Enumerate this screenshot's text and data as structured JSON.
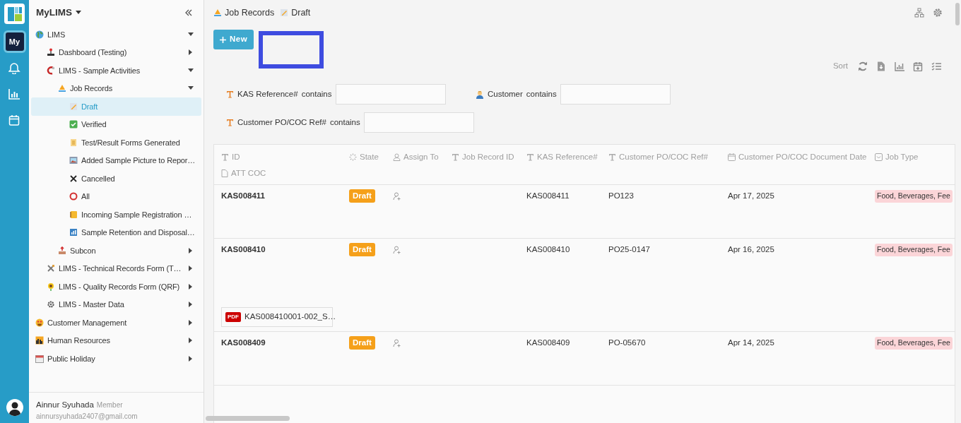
{
  "rail": {
    "items": [
      {
        "label": "My",
        "selected": true
      },
      {
        "selected": false
      },
      {
        "selected": false
      },
      {
        "selected": false
      }
    ]
  },
  "sidebar": {
    "title": "MyLIMS",
    "tree": [
      {
        "label": "LIMS",
        "selected": false,
        "expanded": true,
        "children": [
          {
            "label": "Dashboard (Testing)",
            "selected": false,
            "expanded": false
          },
          {
            "label": "LIMS - Sample Activities",
            "selected": false,
            "expanded": true,
            "children": [
              {
                "label": "Job Records",
                "selected": false,
                "expanded": true,
                "children": [
                  {
                    "label": "Draft",
                    "selected": true
                  },
                  {
                    "label": "Verified",
                    "selected": false
                  },
                  {
                    "label": "Test/Result Forms Generated",
                    "selected": false
                  },
                  {
                    "label": "Added Sample Picture to Repor…",
                    "selected": false
                  },
                  {
                    "label": "Cancelled",
                    "selected": false
                  },
                  {
                    "label": "All",
                    "selected": false
                  },
                  {
                    "label": "Incoming Sample Registration …",
                    "selected": false
                  },
                  {
                    "label": "Sample Retention and Disposal…",
                    "selected": false
                  }
                ]
              },
              {
                "label": "Subcon",
                "selected": false,
                "expanded": false
              }
            ]
          },
          {
            "label": "LIMS - Technical Records Form (T…",
            "selected": false,
            "expanded": false
          },
          {
            "label": "LIMS - Quality Records Form (QRF)",
            "selected": false,
            "expanded": false
          },
          {
            "label": "LIMS - Master Data",
            "selected": false,
            "expanded": false
          }
        ]
      },
      {
        "label": "Customer Management",
        "selected": false,
        "expanded": false
      },
      {
        "label": "Human Resources",
        "selected": false,
        "expanded": false
      },
      {
        "label": "Public Holiday",
        "selected": false,
        "expanded": false
      }
    ]
  },
  "user": {
    "name": "Ainnur Syuhada",
    "role": "Member",
    "email": "ainnursyuhada2407@gmail.com"
  },
  "breadcrumb": [
    "Job Records",
    "Draft"
  ],
  "new_button": "New",
  "toolbar": {
    "sort": "Sort"
  },
  "filters": [
    {
      "kind": "text",
      "label": "KAS Reference#",
      "operator": "contains"
    },
    {
      "kind": "person",
      "label": "Customer",
      "operator": "contains"
    },
    {
      "kind": "text",
      "label": "Customer PO/COC Ref#",
      "operator": "contains"
    }
  ],
  "table": {
    "columns": [
      {
        "label": "ID",
        "kind": "text"
      },
      {
        "label": "State",
        "kind": "status"
      },
      {
        "label": "Assign To",
        "kind": "user"
      },
      {
        "label": "Job Record ID",
        "kind": "text"
      },
      {
        "label": "KAS Reference#",
        "kind": "text"
      },
      {
        "label": "Customer PO/COC Ref#",
        "kind": "text"
      },
      {
        "label": "Customer PO/COC Document Date",
        "kind": "date"
      },
      {
        "label": "Job Type",
        "kind": "select"
      },
      {
        "label": "ATT COC",
        "kind": "file"
      }
    ],
    "rows": [
      {
        "id": "KAS008411",
        "state": "Draft",
        "kas_reference": "KAS008411",
        "customer_po_ref": "PO123",
        "document_date": "Apr 17, 2025",
        "job_type": "Food, Beverages, Fee"
      },
      {
        "id": "KAS008410",
        "state": "Draft",
        "kas_reference": "KAS008410",
        "customer_po_ref": "PO25-0147",
        "document_date": "Apr 16, 2025",
        "job_type": "Food, Beverages, Fee",
        "att_coc": {
          "type": "PDF",
          "name": "KAS008410001-002_S…"
        }
      },
      {
        "id": "KAS008409",
        "state": "Draft",
        "kas_reference": "KAS008409",
        "customer_po_ref": "PO-05670",
        "document_date": "Apr 14, 2025",
        "job_type": "Food, Beverages, Fee"
      }
    ]
  }
}
